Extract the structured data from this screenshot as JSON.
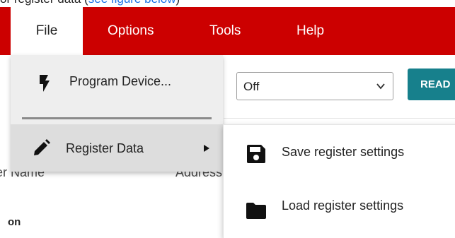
{
  "top_caption": {
    "prefix": "or register data (",
    "link": "see figure below",
    "suffix": ")"
  },
  "menubar": {
    "color": "#cc0000",
    "items": [
      {
        "label": "File",
        "active": true
      },
      {
        "label": "Options"
      },
      {
        "label": "Tools"
      },
      {
        "label": "Help"
      }
    ]
  },
  "background": {
    "select": {
      "value": "Off"
    },
    "read_button": {
      "label": "READ"
    },
    "columns": {
      "name": "ster Name",
      "address": "Address"
    },
    "section_label": "on"
  },
  "file_menu": {
    "items": [
      {
        "label": "Program Device...",
        "icon": "lightning-bolt-icon"
      },
      {
        "label": "Register Data",
        "icon": "pencil-icon",
        "has_submenu": true
      }
    ]
  },
  "submenu": {
    "items": [
      {
        "label": "Save register settings",
        "icon": "floppy-disk-icon"
      },
      {
        "label": "Load register settings",
        "icon": "folder-icon"
      }
    ]
  },
  "colors": {
    "accent_teal": "#17808c",
    "menu_bg": "#eeeeee",
    "highlight": "#dddddd"
  }
}
